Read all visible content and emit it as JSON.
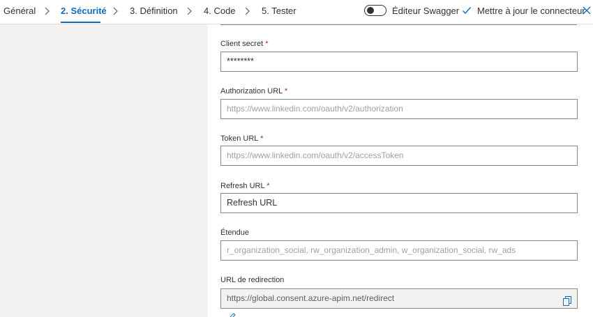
{
  "steps": [
    {
      "label": "Général"
    },
    {
      "label": "2. Sécurité"
    },
    {
      "label": "3. Définition"
    },
    {
      "label": "4. Code"
    },
    {
      "label": "5. Tester"
    }
  ],
  "toolbar": {
    "swagger_toggle_label": "Éditeur Swagger",
    "swagger_toggle_on": false,
    "update_label": "Mettre à jour le connecteur"
  },
  "form": {
    "client_secret": {
      "label": "Client secret",
      "required": "*",
      "value": "********"
    },
    "authorization_url": {
      "label": "Authorization URL",
      "required": "*",
      "placeholder": "https://www.linkedin.com/oauth/v2/authorization"
    },
    "token_url": {
      "label": "Token URL",
      "required": "*",
      "placeholder": "https://www.linkedin.com/oauth/v2/accessToken"
    },
    "refresh_url": {
      "label": "Refresh URL",
      "required": "*",
      "value": "Refresh URL"
    },
    "scope": {
      "label": "Étendue",
      "placeholder": "r_organization_social, rw_organization_admin, w_organization_social, rw_ads"
    },
    "redirect_url": {
      "label": "URL de redirection",
      "value": "https://global.consent.azure-apim.net/redirect"
    }
  },
  "colors": {
    "accent": "#0f6cbd",
    "required": "#a4262c",
    "panel": "#f3f2f1"
  }
}
